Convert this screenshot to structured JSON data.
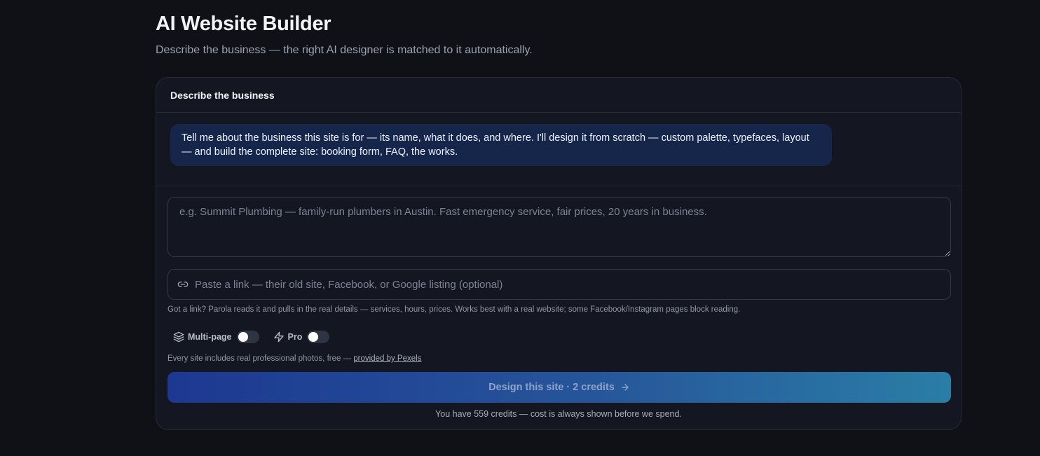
{
  "header": {
    "title": "AI Website Builder",
    "subtitle": "Describe the business — the right AI designer is matched to it automatically."
  },
  "card": {
    "title": "Describe the business",
    "assistant_message": "Tell me about the business this site is for — its name, what it does, and where. I'll design it from scratch — custom palette, typefaces, layout — and build the complete site: booking form, FAQ, the works.",
    "description_input": {
      "value": "",
      "placeholder": "e.g. Summit Plumbing — family-run plumbers in Austin. Fast emergency service, fair prices, 20 years in business."
    },
    "link_input": {
      "value": "",
      "placeholder": "Paste a link — their old site, Facebook, or Google listing (optional)",
      "icon": "link-icon"
    },
    "link_hint": "Got a link? Parola reads it and pulls in the real details — services, hours, prices. Works best with a real website; some Facebook/Instagram pages block reading.",
    "toggles": {
      "multipage": {
        "label": "Multi-page",
        "enabled": false,
        "icon": "layers-icon"
      },
      "pro": {
        "label": "Pro",
        "enabled": false,
        "icon": "lightning-icon"
      }
    },
    "photos_note": "Every site includes real professional photos, free — ",
    "photos_link": "provided by Pexels",
    "submit_label": "Design this site · 2 credits",
    "credits_note": "You have 559 credits — cost is always shown before we spend."
  },
  "colors": {
    "background": "#0f1117",
    "card": "#141722",
    "bubble": "#16264a",
    "button_gradient_start": "#1d3891",
    "button_gradient_end": "#2a7ea6"
  }
}
